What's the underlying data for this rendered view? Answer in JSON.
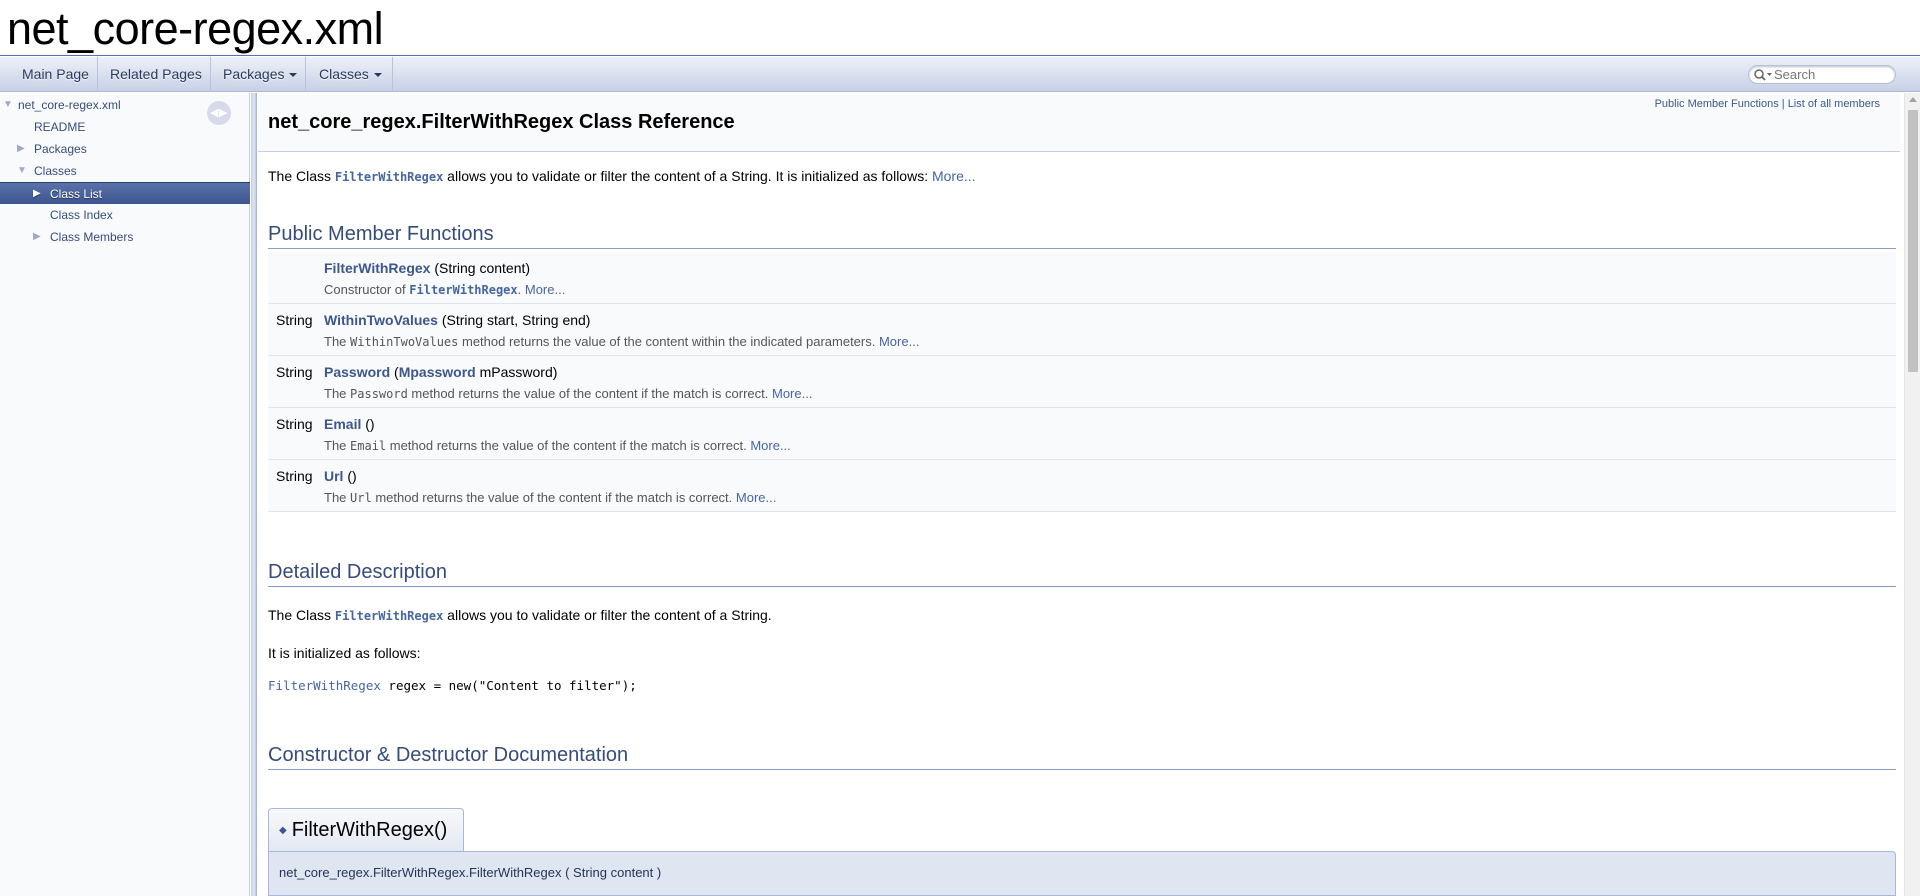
{
  "project": {
    "name": "net_core-regex.xml"
  },
  "nav": {
    "main_page": "Main Page",
    "related_pages": "Related Pages",
    "packages": "Packages",
    "classes": "Classes",
    "search_placeholder": "Search"
  },
  "tree": {
    "root": "net_core-regex.xml",
    "readme": "README",
    "packages": "Packages",
    "classes": "Classes",
    "class_list": "Class List",
    "class_index": "Class Index",
    "class_members": "Class Members"
  },
  "header": {
    "title": "net_core_regex.FilterWithRegex Class Reference",
    "summary_public": "Public Member Functions",
    "summary_sep": " | ",
    "summary_all": "List of all members"
  },
  "brief": {
    "pre": "The Class ",
    "code": "FilterWithRegex",
    "post": " allows you to validate or filter the content of a String. It is initialized as follows: ",
    "more": "More..."
  },
  "sections": {
    "public_functions": "Public Member Functions",
    "detailed": "Detailed Description",
    "ctor": "Constructor & Destructor Documentation"
  },
  "members": [
    {
      "type": "",
      "name": "FilterWithRegex",
      "args": " (String content)",
      "desc_pre": "Constructor of ",
      "desc_code": "FilterWithRegex",
      "desc_post": ". ",
      "more": "More..."
    },
    {
      "type": "String",
      "name": "WithinTwoValues",
      "args": " (String start, String end)",
      "desc_pre": "The ",
      "desc_code": "WithinTwoValues",
      "desc_post": " method returns the value of the content within the indicated parameters. ",
      "more": "More..."
    },
    {
      "type": "String",
      "name": "Password",
      "args_open": " (",
      "args_link": "Mpassword",
      "args_close": " mPassword)",
      "desc_pre": "The ",
      "desc_code": "Password",
      "desc_post": " method returns the value of the content if the match is correct. ",
      "more": "More..."
    },
    {
      "type": "String",
      "name": "Email",
      "args": " ()",
      "desc_pre": "The ",
      "desc_code": "Email",
      "desc_post": " method returns the value of the content if the match is correct. ",
      "more": "More..."
    },
    {
      "type": "String",
      "name": "Url",
      "args": " ()",
      "desc_pre": "The ",
      "desc_code": "Url",
      "desc_post": " method returns the value of the content if the match is correct. ",
      "more": "More..."
    }
  ],
  "detailed": {
    "line1_pre": "The Class ",
    "line1_code": "FilterWithRegex",
    "line1_post": " allows you to validate or filter the content of a String.",
    "line2": "It is initialized as follows:",
    "code_class": "FilterWithRegex",
    "code_rest": " regex = new(\"Content to filter\");"
  },
  "ctor": {
    "title": "FilterWithRegex()",
    "proto": "net_core_regex.FilterWithRegex.FilterWithRegex ( String  content )"
  },
  "colors": {
    "link": "#3d578c",
    "header_text": "#354c7b",
    "selected_bg": "#4a6298"
  }
}
